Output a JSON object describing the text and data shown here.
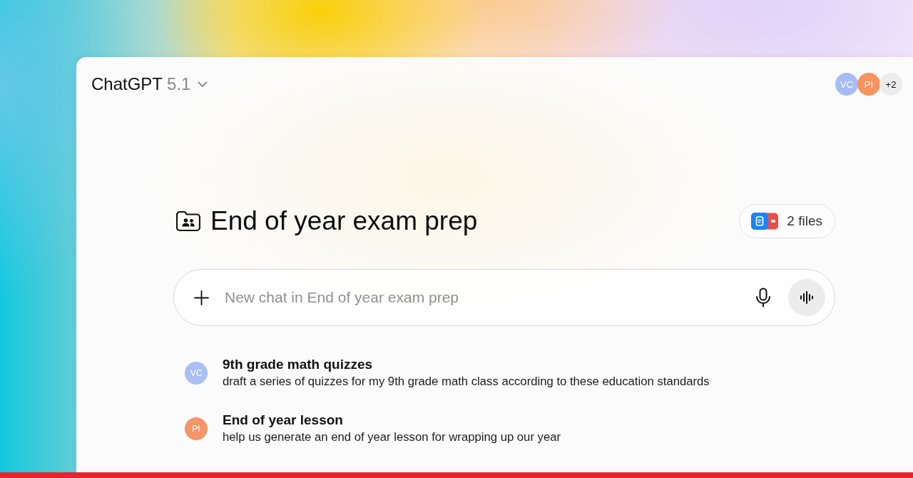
{
  "header": {
    "model_name": "ChatGPT",
    "model_version": "5.1"
  },
  "members": [
    {
      "initials": "VC",
      "color": "#a7bcf6"
    },
    {
      "initials": "PI",
      "color": "#f6935f"
    }
  ],
  "members_overflow": "+2",
  "project": {
    "title": "End of year exam prep",
    "files_label": "2 files"
  },
  "composer": {
    "placeholder": "New chat in End of year exam prep"
  },
  "chats": [
    {
      "initials": "VC",
      "color": "#a9bff6",
      "title": "9th grade math quizzes",
      "preview": "draft a series of quizzes for my 9th grade math class according to these education standards"
    },
    {
      "initials": "PI",
      "color": "#f5956a",
      "title": "End of year lesson",
      "preview": "help us generate an end of year lesson for wrapping up our year"
    }
  ]
}
